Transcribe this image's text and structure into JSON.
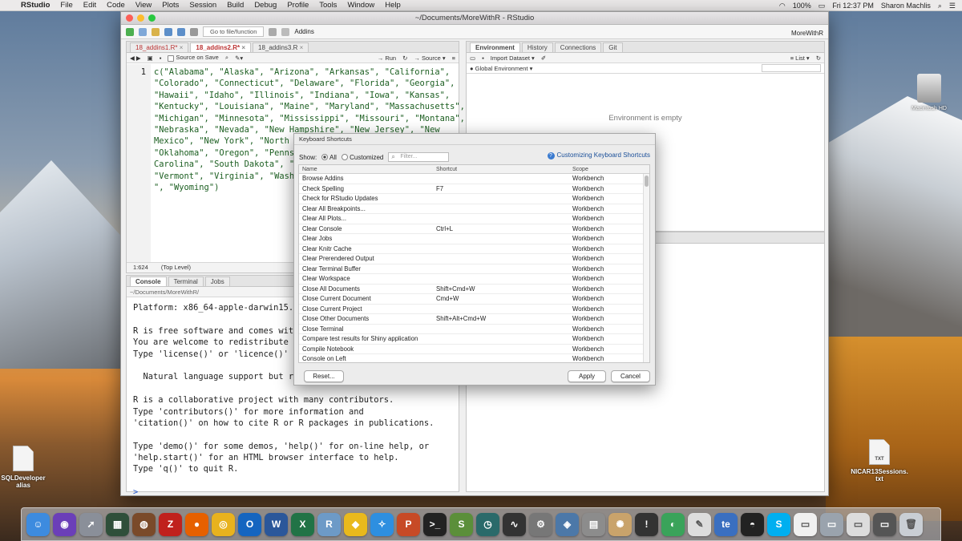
{
  "menubar": {
    "app": "RStudio",
    "items": [
      "File",
      "Edit",
      "Code",
      "View",
      "Plots",
      "Session",
      "Build",
      "Debug",
      "Profile",
      "Tools",
      "Window",
      "Help"
    ],
    "battery": "100%",
    "clock": "Fri 12:37 PM",
    "user": "Sharon Machlis"
  },
  "window": {
    "title": "~/Documents/MoreWithR - RStudio",
    "goto_placeholder": "Go to file/function",
    "addins": "Addins",
    "project": "MoreWithR"
  },
  "editor": {
    "tabs": [
      {
        "label": "18_addins1.R*",
        "modified": true
      },
      {
        "label": "18_addins2.R*",
        "modified": true
      },
      {
        "label": "18_addins3.R",
        "modified": false
      }
    ],
    "source_on_save": "Source on Save",
    "run": "Run",
    "source": "Source",
    "line_number": "1",
    "lines": [
      "c(\"Alabama\", \"Alaska\", \"Arizona\", \"Arkansas\", \"California\",",
      "\"Colorado\", \"Connecticut\", \"Delaware\", \"Florida\", \"Georgia\",",
      "\"Hawaii\", \"Idaho\", \"Illinois\", \"Indiana\", \"Iowa\", \"Kansas\",",
      "\"Kentucky\", \"Louisiana\", \"Maine\", \"Maryland\", \"Massachusetts\",",
      "\"Michigan\", \"Minnesota\", \"Mississippi\", \"Missouri\", \"Montana\",",
      "\"Nebraska\", \"Nevada\", \"New Hampshire\", \"New Jersey\", \"New",
      "Mexico\", \"New York\", \"North Ca",
      "\"Oklahoma\", \"Oregon\", \"Pennsyl",
      "Carolina\", \"South Dakota\", \"Te",
      "\"Vermont\", \"Virginia\", \"Washin",
      "\", \"Wyoming\")"
    ],
    "status_pos": "1:624",
    "status_level": "(Top Level)"
  },
  "console": {
    "tabs": [
      "Console",
      "Terminal",
      "Jobs"
    ],
    "path": "~/Documents/MoreWithR/",
    "lines": [
      "Platform: x86_64-apple-darwin15.6.0",
      "",
      "R is free software and comes with A",
      "You are welcome to redistribute it",
      "Type 'license()' or 'licence()' fo",
      "",
      "  Natural language support but runn",
      "",
      "R is a collaborative project with many contributors.",
      "Type 'contributors()' for more information and",
      "'citation()' on how to cite R or R packages in publications.",
      "",
      "Type 'demo()' for some demos, 'help()' for on-line help, or",
      "'help.start()' for an HTML browser interface to help.",
      "Type 'q()' to quit R.",
      "",
      ">"
    ]
  },
  "environment": {
    "tabs": [
      "Environment",
      "History",
      "Connections",
      "Git"
    ],
    "import": "Import Dataset",
    "list": "List",
    "scope": "Global Environment",
    "empty": "Environment is empty"
  },
  "dialog": {
    "title": "Keyboard Shortcuts",
    "show": "Show:",
    "all": "All",
    "customized": "Customized",
    "filter_placeholder": "Filter...",
    "help_link": "Customizing Keyboard Shortcuts",
    "columns": [
      "Name",
      "Shortcut",
      "Scope"
    ],
    "rows": [
      {
        "name": "Browse Addins",
        "shortcut": "",
        "scope": "Workbench"
      },
      {
        "name": "Check Spelling",
        "shortcut": "F7",
        "scope": "Workbench"
      },
      {
        "name": "Check for RStudio Updates",
        "shortcut": "",
        "scope": "Workbench"
      },
      {
        "name": "Clear All Breakpoints...",
        "shortcut": "",
        "scope": "Workbench"
      },
      {
        "name": "Clear All Plots...",
        "shortcut": "",
        "scope": "Workbench"
      },
      {
        "name": "Clear Console",
        "shortcut": "Ctrl+L",
        "scope": "Workbench"
      },
      {
        "name": "Clear Jobs",
        "shortcut": "",
        "scope": "Workbench"
      },
      {
        "name": "Clear Knitr Cache",
        "shortcut": "",
        "scope": "Workbench"
      },
      {
        "name": "Clear Prerendered Output",
        "shortcut": "",
        "scope": "Workbench"
      },
      {
        "name": "Clear Terminal Buffer",
        "shortcut": "",
        "scope": "Workbench"
      },
      {
        "name": "Clear Workspace",
        "shortcut": "",
        "scope": "Workbench"
      },
      {
        "name": "Close All Documents",
        "shortcut": "Shift+Cmd+W",
        "scope": "Workbench"
      },
      {
        "name": "Close Current Document",
        "shortcut": "Cmd+W",
        "scope": "Workbench"
      },
      {
        "name": "Close Current Project",
        "shortcut": "",
        "scope": "Workbench"
      },
      {
        "name": "Close Other Documents",
        "shortcut": "Shift+Alt+Cmd+W",
        "scope": "Workbench"
      },
      {
        "name": "Close Terminal",
        "shortcut": "",
        "scope": "Workbench"
      },
      {
        "name": "Compare test results for Shiny application",
        "shortcut": "",
        "scope": "Workbench"
      },
      {
        "name": "Compile Notebook",
        "shortcut": "",
        "scope": "Workbench"
      },
      {
        "name": "Console on Left",
        "shortcut": "",
        "scope": "Workbench"
      }
    ],
    "reset": "Reset...",
    "apply": "Apply",
    "cancel": "Cancel"
  },
  "desktop": {
    "sql_label_1": "SQLDeveloper",
    "sql_label_2": "alias",
    "nicar_label_1": "NICAR13Sessions.",
    "nicar_label_2": "txt",
    "txt_badge": "TXT",
    "drive_label": "Macintosh HD"
  },
  "dock": {
    "items": [
      {
        "name": "finder",
        "color": "#3d8bdf",
        "glyph": "☺"
      },
      {
        "name": "siri",
        "color": "#6b3fb8",
        "glyph": "◉"
      },
      {
        "name": "launchpad",
        "color": "#8a8f99",
        "glyph": "➚"
      },
      {
        "name": "mission-control",
        "color": "#2f4f3a",
        "glyph": "▦"
      },
      {
        "name": "app-brown",
        "color": "#7a4a2a",
        "glyph": "◍"
      },
      {
        "name": "filezilla",
        "color": "#c0211d",
        "glyph": "Z"
      },
      {
        "name": "firefox",
        "color": "#e66000",
        "glyph": "●"
      },
      {
        "name": "chrome",
        "color": "#e8b21e",
        "glyph": "◎"
      },
      {
        "name": "outlook",
        "color": "#1565c0",
        "glyph": "O"
      },
      {
        "name": "word",
        "color": "#2b579a",
        "glyph": "W"
      },
      {
        "name": "excel",
        "color": "#217346",
        "glyph": "X"
      },
      {
        "name": "rstudio",
        "color": "#6d9ac7",
        "glyph": "R"
      },
      {
        "name": "app-yellow",
        "color": "#e9b91d",
        "glyph": "◆"
      },
      {
        "name": "safari",
        "color": "#2e8fe0",
        "glyph": "✧"
      },
      {
        "name": "powerpoint",
        "color": "#c74a26",
        "glyph": "P"
      },
      {
        "name": "terminal",
        "color": "#222222",
        "glyph": ">_"
      },
      {
        "name": "app-s",
        "color": "#5b8f3a",
        "glyph": "S"
      },
      {
        "name": "time-machine",
        "color": "#2a6a6a",
        "glyph": "◷"
      },
      {
        "name": "activity-monitor",
        "color": "#333333",
        "glyph": "∿"
      },
      {
        "name": "system-preferences",
        "color": "#777777",
        "glyph": "⚙"
      },
      {
        "name": "app-blue",
        "color": "#4c78a8",
        "glyph": "◈"
      },
      {
        "name": "calculator",
        "color": "#8c8c8c",
        "glyph": "▤"
      },
      {
        "name": "app-tan",
        "color": "#c9a36b",
        "glyph": "✺"
      },
      {
        "name": "console-app",
        "color": "#333333",
        "glyph": "!"
      },
      {
        "name": "app-green",
        "color": "#3aa35a",
        "glyph": "◐"
      },
      {
        "name": "preview",
        "color": "#dddddd",
        "glyph": "✎"
      },
      {
        "name": "app-te",
        "color": "#3a6fc0",
        "glyph": "te"
      },
      {
        "name": "app-dark",
        "color": "#222222",
        "glyph": "◓"
      },
      {
        "name": "skype",
        "color": "#00aff0",
        "glyph": "S"
      },
      {
        "name": "document",
        "color": "#f0f0f0",
        "glyph": "▭"
      },
      {
        "name": "app-window",
        "color": "#9aa3ad",
        "glyph": "▭"
      },
      {
        "name": "app-window-2",
        "color": "#dcdcdc",
        "glyph": "▭"
      },
      {
        "name": "app-window-3",
        "color": "#555555",
        "glyph": "▭"
      },
      {
        "name": "trash",
        "color": "#c9ced4",
        "glyph": "🗑"
      }
    ]
  }
}
